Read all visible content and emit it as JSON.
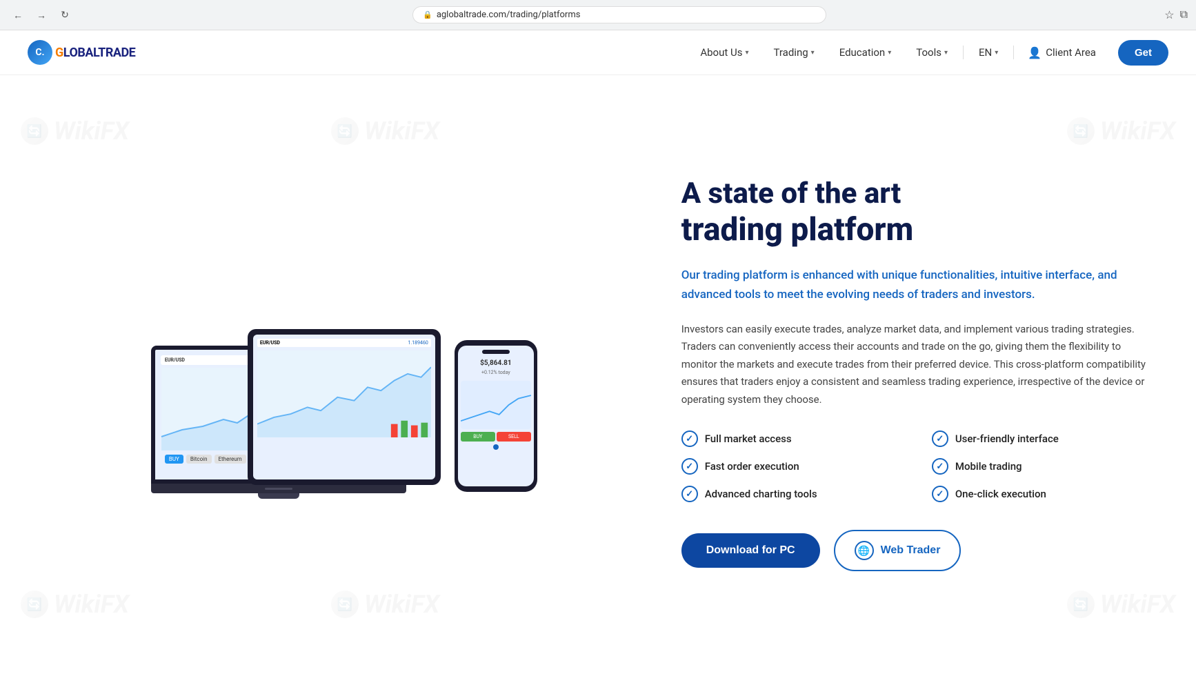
{
  "browser": {
    "url": "aglobaltrade.com/trading/platforms",
    "back_label": "←",
    "forward_label": "→",
    "refresh_label": "↻"
  },
  "navbar": {
    "logo_initials": "C.",
    "logo_name": "GLOBALTRADE",
    "nav_items": [
      {
        "label": "About Us",
        "has_dropdown": true
      },
      {
        "label": "Trading",
        "has_dropdown": true
      },
      {
        "label": "Education",
        "has_dropdown": true
      },
      {
        "label": "Tools",
        "has_dropdown": true
      },
      {
        "label": "EN",
        "has_dropdown": true
      }
    ],
    "client_area_label": "Client Area",
    "get_button_label": "Get"
  },
  "hero": {
    "title_line1": "A state of the art",
    "title_line2": "trading platform",
    "subtitle": "Our trading platform is enhanced with unique functionalities, intuitive interface, and advanced tools to meet the evolving needs of traders and investors.",
    "description": "Investors can easily execute trades, analyze market data, and implement various trading strategies. Traders can conveniently access their accounts and trade on the go, giving them the flexibility to monitor the markets and execute trades from their preferred device. This cross-platform compatibility ensures that traders enjoy a consistent and seamless trading experience, irrespective of the device or operating system they choose.",
    "features": [
      {
        "label": "Full market access"
      },
      {
        "label": "User-friendly interface"
      },
      {
        "label": "Fast order execution"
      },
      {
        "label": "Mobile trading"
      },
      {
        "label": "Advanced charting tools"
      },
      {
        "label": "One-click execution"
      }
    ],
    "btn_download_label": "Download for PC",
    "btn_webtrader_label": "Web Trader"
  },
  "watermark": {
    "text": "WikiFX"
  },
  "screen": {
    "pair": "EUR/USD",
    "price": "1.189460",
    "phone_price": "$5,864.81"
  }
}
